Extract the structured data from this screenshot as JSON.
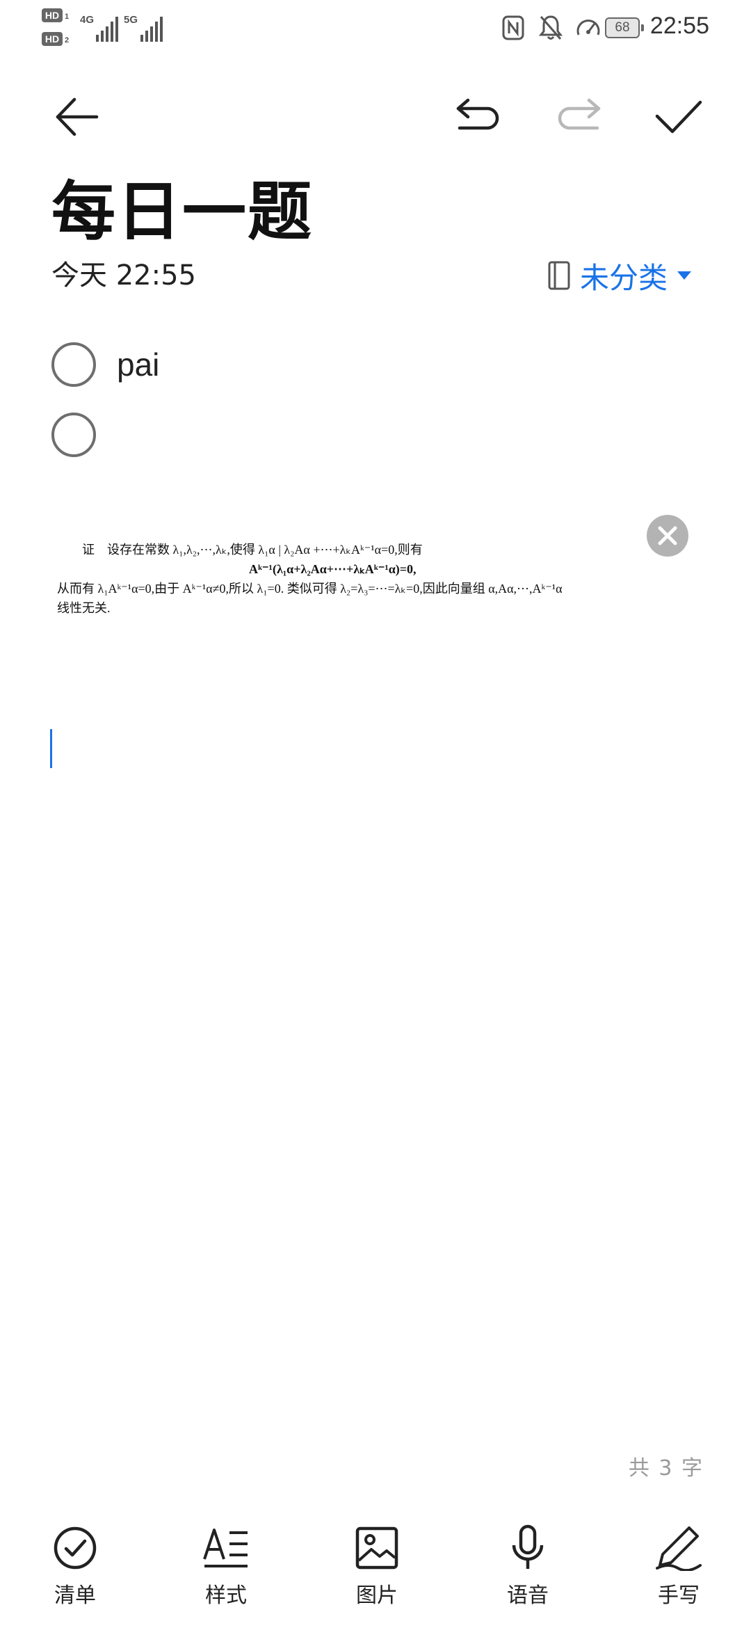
{
  "status_bar": {
    "hd1": "HD",
    "hd1_sub": "1",
    "hd2": "HD",
    "hd2_sub": "2",
    "net1": "4G",
    "net2": "5G",
    "battery": "68",
    "time": "22:55"
  },
  "toolbar": {
    "back_icon": "arrow-left-icon",
    "undo_icon": "undo-icon",
    "redo_icon": "redo-icon",
    "redo_enabled": false,
    "done_icon": "checkmark-icon"
  },
  "note": {
    "title": "每日一题",
    "date": "今天 22:55",
    "category": "未分类",
    "category_icon": "notebook-icon"
  },
  "checklist": [
    {
      "text": "pai",
      "checked": false
    },
    {
      "text": "",
      "checked": false
    }
  ],
  "image_text": {
    "line1": "证　设存在常数 λ₁,λ₂,⋯,λₖ,使得 λ₁α | λ₂Aα +⋯+λₖAᵏ⁻¹α=0,则有",
    "line2": "Aᵏ⁻¹(λ₁α+λ₂Aα+⋯+λₖAᵏ⁻¹α)=0,",
    "line3": "从而有 λ₁Aᵏ⁻¹α=0,由于 Aᵏ⁻¹α≠0,所以 λ₁=0. 类似可得 λ₂=λ₃=⋯=λₖ=0,因此向量组 α,Aα,⋯,Aᵏ⁻¹α",
    "line4": "线性无关."
  },
  "word_count": "共 3 字",
  "bottom_toolbar": [
    {
      "label": "清单",
      "icon": "checklist-icon"
    },
    {
      "label": "样式",
      "icon": "text-style-icon"
    },
    {
      "label": "图片",
      "icon": "image-icon"
    },
    {
      "label": "语音",
      "icon": "microphone-icon"
    },
    {
      "label": "手写",
      "icon": "handwriting-pen-icon"
    }
  ],
  "colors": {
    "accent": "#1a73e8",
    "icon": "#333333",
    "disabled": "#b8b8b8"
  }
}
